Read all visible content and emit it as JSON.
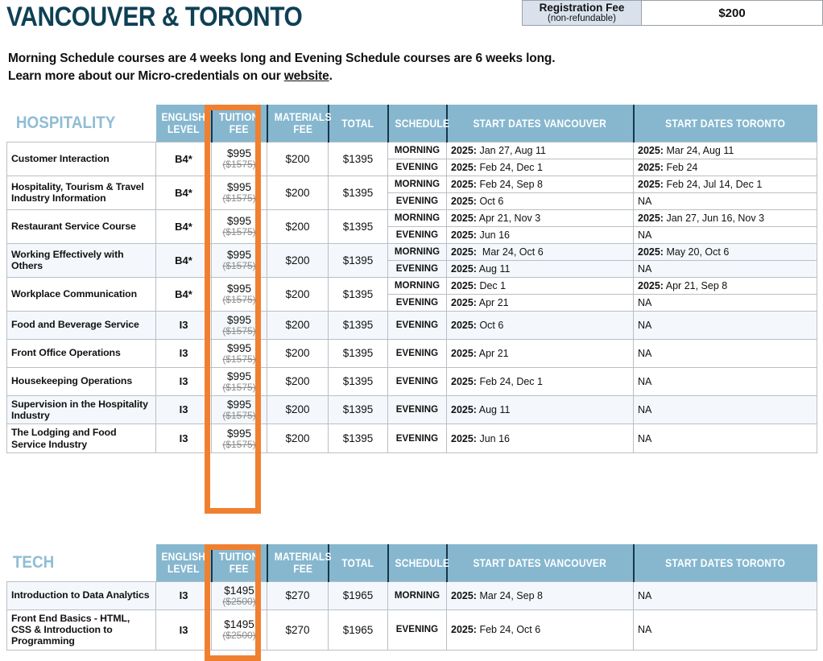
{
  "header": {
    "title": "VANCOUVER & TORONTO",
    "registration_fee": {
      "label_line1": "Registration Fee",
      "label_line2": "(non-refundable)",
      "value": "$200"
    }
  },
  "intro": {
    "line1": "Morning Schedule courses are 4 weeks long and Evening Schedule courses are 6 weeks long.",
    "line2_pre": "Learn more about our Micro-credentials on our ",
    "line2_link": "website",
    "line2_post": "."
  },
  "colors": {
    "title": "#0f4055",
    "header_bg": "#86b7cf",
    "section_title": "#8fbdd4",
    "highlight": "#f08030",
    "row_shade": "#f4f8fc",
    "regfee_label_bg": "#d9e2ec"
  },
  "columns": {
    "english_level": "ENGLISH\nLEVEL",
    "tuition_fee": "TUITION\nFEE",
    "materials_fee": "MATERIALS\nFEE",
    "total": "TOTAL",
    "schedule": "SCHEDULE",
    "start_dates_vancouver": "START DATES VANCOUVER",
    "start_dates_toronto": "START DATES TORONTO"
  },
  "tables": [
    {
      "section": "HOSPITALITY",
      "rows": [
        {
          "course": "Customer Interaction",
          "level": "B4*",
          "tuition_new": "$995",
          "tuition_old": "($1575)",
          "materials": "$200",
          "total": "$1395",
          "shaded": false,
          "schedules": [
            {
              "schedule": "MORNING",
              "vancouver_year": "2025:",
              "vancouver_dates": " Jan 27, Aug 11",
              "toronto_year": "2025:",
              "toronto_dates": " Mar 24, Aug 11"
            },
            {
              "schedule": "EVENING",
              "vancouver_year": "2025:",
              "vancouver_dates": " Feb 24, Dec 1",
              "toronto_year": "2025:",
              "toronto_dates": " Feb 24"
            }
          ]
        },
        {
          "course": "Hospitality, Tourism & Travel Industry Information",
          "level": "B4*",
          "tuition_new": "$995",
          "tuition_old": "($1575)",
          "materials": "$200",
          "total": "$1395",
          "shaded": false,
          "schedules": [
            {
              "schedule": "MORNING",
              "vancouver_year": "2025:",
              "vancouver_dates": " Feb 24, Sep 8",
              "toronto_year": "2025:",
              "toronto_dates": " Feb 24, Jul 14, Dec 1"
            },
            {
              "schedule": "EVENING",
              "vancouver_year": "2025:",
              "vancouver_dates": " Oct 6",
              "toronto_year": "",
              "toronto_dates": "NA"
            }
          ]
        },
        {
          "course": "Restaurant Service Course",
          "level": "B4*",
          "tuition_new": "$995",
          "tuition_old": "($1575)",
          "materials": "$200",
          "total": "$1395",
          "shaded": false,
          "schedules": [
            {
              "schedule": "MORNING",
              "vancouver_year": "2025:",
              "vancouver_dates": " Apr 21, Nov 3",
              "toronto_year": "2025:",
              "toronto_dates": " Jan 27, Jun 16, Nov 3"
            },
            {
              "schedule": "EVENING",
              "vancouver_year": "2025:",
              "vancouver_dates": " Jun 16",
              "toronto_year": "",
              "toronto_dates": "NA"
            }
          ]
        },
        {
          "course": "Working Effectively with Others",
          "level": "B4*",
          "tuition_new": "$995",
          "tuition_old": "($1575)",
          "materials": "$200",
          "total": "$1395",
          "shaded": true,
          "schedules": [
            {
              "schedule": "MORNING",
              "vancouver_year": "2025:",
              "vancouver_dates": "  Mar 24, Oct 6",
              "toronto_year": "2025:",
              "toronto_dates": " May 20, Oct 6"
            },
            {
              "schedule": "EVENING",
              "vancouver_year": "2025:",
              "vancouver_dates": " Aug 11",
              "toronto_year": "",
              "toronto_dates": "NA"
            }
          ]
        },
        {
          "course": "Workplace Communication",
          "level": "B4*",
          "tuition_new": "$995",
          "tuition_old": "($1575)",
          "materials": "$200",
          "total": "$1395",
          "shaded": false,
          "schedules": [
            {
              "schedule": "MORNING",
              "vancouver_year": "2025:",
              "vancouver_dates": " Dec 1",
              "toronto_year": "2025:",
              "toronto_dates": " Apr 21, Sep 8"
            },
            {
              "schedule": "EVENING",
              "vancouver_year": "2025:",
              "vancouver_dates": " Apr 21",
              "toronto_year": "",
              "toronto_dates": "NA"
            }
          ]
        },
        {
          "course": "Food and Beverage Service",
          "level": "I3",
          "tuition_new": "$995",
          "tuition_old": "($1575)",
          "materials": "$200",
          "total": "$1395",
          "shaded": true,
          "schedules": [
            {
              "schedule": "EVENING",
              "vancouver_year": "2025:",
              "vancouver_dates": " Oct 6",
              "toronto_year": "",
              "toronto_dates": "NA"
            }
          ]
        },
        {
          "course": "Front Office Operations",
          "level": "I3",
          "tuition_new": "$995",
          "tuition_old": "($1575)",
          "materials": "$200",
          "total": "$1395",
          "shaded": false,
          "schedules": [
            {
              "schedule": "EVENING",
              "vancouver_year": "2025:",
              "vancouver_dates": " Apr 21",
              "toronto_year": "",
              "toronto_dates": "NA"
            }
          ]
        },
        {
          "course": "Housekeeping Operations",
          "level": "I3",
          "tuition_new": "$995",
          "tuition_old": "($1575)",
          "materials": "$200",
          "total": "$1395",
          "shaded": false,
          "schedules": [
            {
              "schedule": "EVENING",
              "vancouver_year": "2025:",
              "vancouver_dates": " Feb 24, Dec 1",
              "toronto_year": "",
              "toronto_dates": "NA"
            }
          ]
        },
        {
          "course": "Supervision in the Hospitality Industry",
          "level": "I3",
          "tuition_new": "$995",
          "tuition_old": "($1575)",
          "materials": "$200",
          "total": "$1395",
          "shaded": true,
          "schedules": [
            {
              "schedule": "EVENING",
              "vancouver_year": "2025:",
              "vancouver_dates": " Aug 11",
              "toronto_year": "",
              "toronto_dates": "NA"
            }
          ]
        },
        {
          "course": "The Lodging and Food Service Industry",
          "level": "I3",
          "tuition_new": "$995",
          "tuition_old": "($1575)",
          "materials": "$200",
          "total": "$1395",
          "shaded": false,
          "schedules": [
            {
              "schedule": "EVENING",
              "vancouver_year": "2025:",
              "vancouver_dates": " Jun 16",
              "toronto_year": "",
              "toronto_dates": "NA"
            }
          ]
        }
      ]
    },
    {
      "section": "TECH",
      "rows": [
        {
          "course": "Introduction to Data Analytics",
          "level": "I3",
          "tuition_new": "$1495",
          "tuition_old": "($2500)",
          "materials": "$270",
          "total": "$1965",
          "shaded": true,
          "schedules": [
            {
              "schedule": "MORNING",
              "vancouver_year": "2025:",
              "vancouver_dates": " Mar 24, Sep 8",
              "toronto_year": "",
              "toronto_dates": "NA"
            }
          ]
        },
        {
          "course": "Front End Basics - HTML, CSS & Introduction to Programming",
          "level": "I3",
          "tuition_new": "$1495",
          "tuition_old": "($2500)",
          "materials": "$270",
          "total": "$1965",
          "shaded": false,
          "schedules": [
            {
              "schedule": "EVENING",
              "vancouver_year": "2025:",
              "vancouver_dates": " Feb 24, Oct 6",
              "toronto_year": "",
              "toronto_dates": "NA"
            }
          ]
        }
      ]
    }
  ]
}
